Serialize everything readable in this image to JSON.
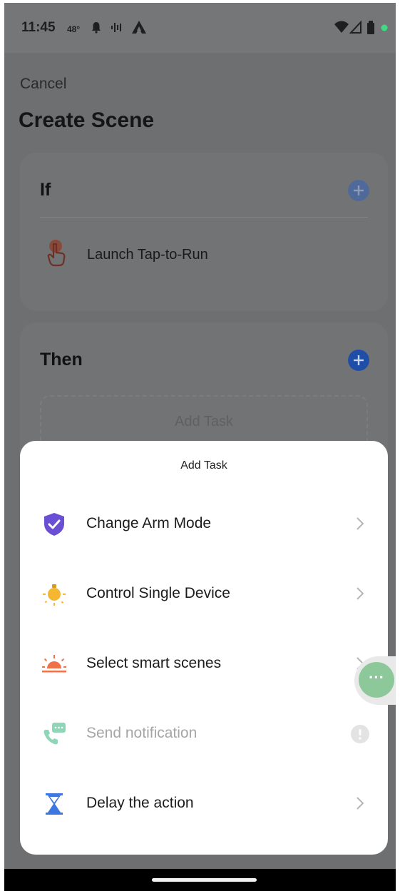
{
  "status_bar": {
    "time": "11:45",
    "temperature": "48°",
    "icons": [
      "alarm-icon",
      "voicemail-icon",
      "app-icon",
      "wifi-icon",
      "signal-icon",
      "battery-icon",
      "dot-icon"
    ],
    "indicator_color": "#3ddc84"
  },
  "header": {
    "cancel_label": "Cancel",
    "title": "Create Scene"
  },
  "if_card": {
    "heading": "If",
    "condition_label": "Launch Tap-to-Run",
    "plus_color": "#4f6a9a"
  },
  "then_card": {
    "heading": "Then",
    "add_task_label": "Add Task",
    "plus_color": "#1f4ea8"
  },
  "sheet": {
    "title": "Add Task",
    "items": [
      {
        "label": "Change Arm Mode",
        "icon": "shield-check-icon",
        "enabled": true
      },
      {
        "label": "Control Single Device",
        "icon": "bulb-icon",
        "enabled": true
      },
      {
        "label": "Select smart scenes",
        "icon": "sunrise-icon",
        "enabled": true
      },
      {
        "label": "Send notification",
        "icon": "phone-message-icon",
        "enabled": false
      },
      {
        "label": "Delay the action",
        "icon": "hourglass-icon",
        "enabled": true
      }
    ]
  },
  "floating_button": {
    "icon": "more-dots-icon",
    "label": "···"
  },
  "colors": {
    "overlay": "#6e6f71",
    "sheet_bg": "#ffffff",
    "shield": "#6a4fd4",
    "bulb": "#f5b731",
    "sunrise": "#f07048",
    "notification": "#8fd6b8",
    "hourglass": "#3d78e0"
  }
}
